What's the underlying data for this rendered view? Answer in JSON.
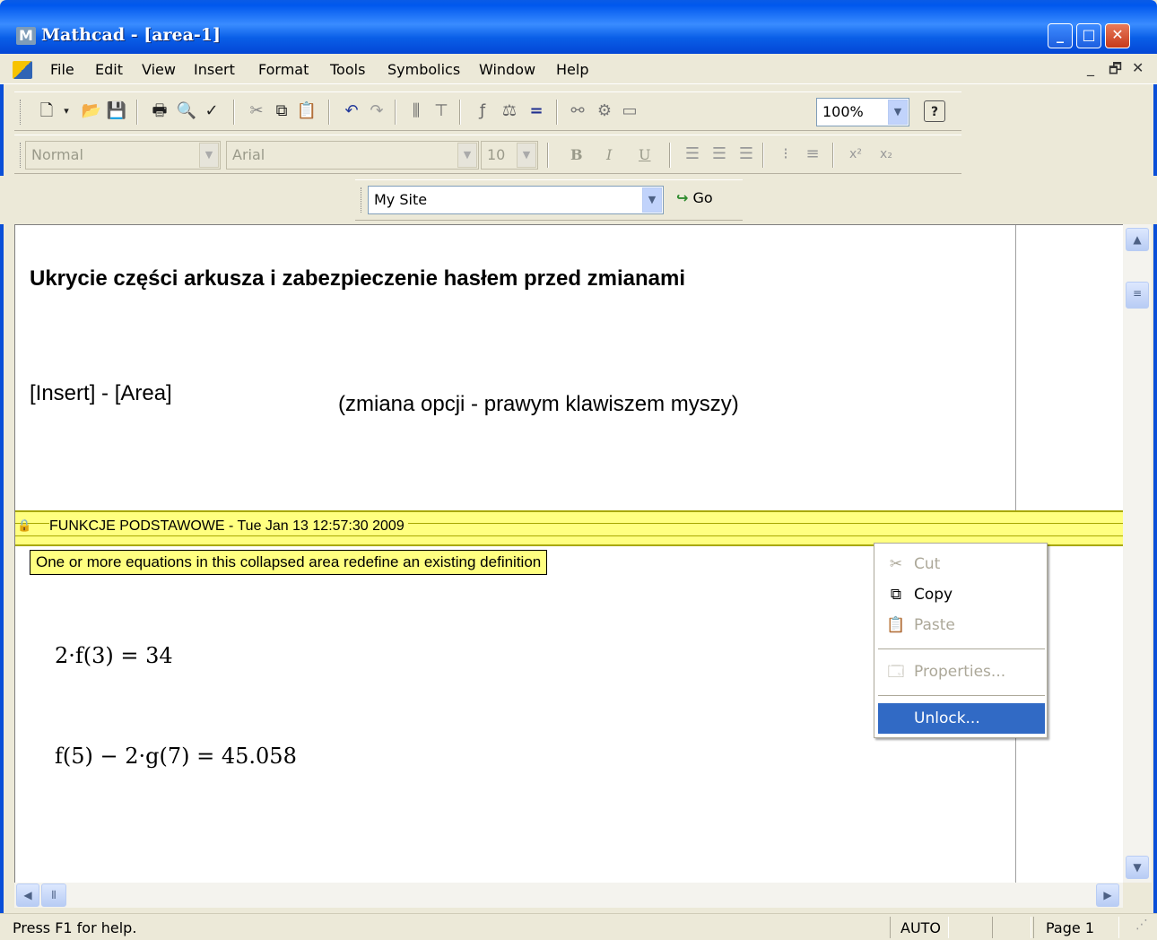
{
  "window": {
    "title": "Mathcad - [area-1]",
    "app_icon_letter": "M",
    "minimize": "_",
    "maximize": "□",
    "close": "✕"
  },
  "menu": {
    "items": [
      "File",
      "Edit",
      "View",
      "Insert",
      "Format",
      "Tools",
      "Symbolics",
      "Window",
      "Help"
    ],
    "doc_controls": [
      "_",
      "🗗",
      "✕"
    ]
  },
  "standard_toolbar": {
    "zoom_value": "100%"
  },
  "format_toolbar": {
    "style_value": "Normal",
    "font_value": "Arial",
    "size_value": "10",
    "bold": "B",
    "italic": "I",
    "underline": "U"
  },
  "web_toolbar": {
    "address_value": "My Site",
    "go_label": "Go"
  },
  "worksheet": {
    "heading": "Ukrycie części arkusza i zabezpieczenie hasłem przed zmianami",
    "insert_text": "[Insert] - [Area]",
    "note_text": "(zmiana opcji - prawym klawiszem myszy)",
    "area_label": "FUNKCJE PODSTAWOWE - Tue Jan 13 12:57:30 2009",
    "tooltip": "One or more equations in this collapsed area redefine an existing definition",
    "equation_1": "2·f(3) = 34",
    "equation_2": "f(5) − 2·g(7) = 45.058"
  },
  "context_menu": {
    "cut": "Cut",
    "copy": "Copy",
    "paste": "Paste",
    "properties": "Properties...",
    "unlock": "Unlock..."
  },
  "status": {
    "help": "Press F1 for help.",
    "mode": "AUTO",
    "page": "Page 1"
  },
  "colors": {
    "area_highlight": "#FFFF80",
    "menu_selection": "#316AC5",
    "titlebar_blue": "#0058EE"
  }
}
